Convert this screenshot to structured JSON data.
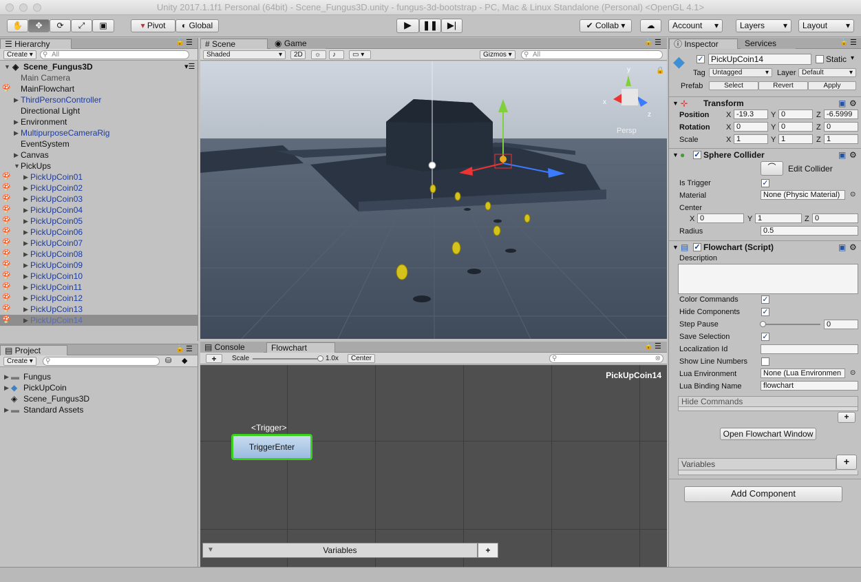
{
  "window_title": "Unity 2017.1.1f1 Personal (64bit) - Scene_Fungus3D.unity - fungus-3d-bootstrap - PC, Mac & Linux Standalone (Personal) <OpenGL 4.1>",
  "toolbar": {
    "pivot": "Pivot",
    "global": "Global",
    "collab": "Collab",
    "account": "Account",
    "layers": "Layers",
    "layout": "Layout"
  },
  "hierarchy": {
    "tab": "Hierarchy",
    "create": "Create",
    "search_placeholder": "All",
    "scene": "Scene_Fungus3D",
    "items": [
      {
        "label": "Main Camera"
      },
      {
        "label": "MainFlowchart"
      },
      {
        "label": "ThirdPersonController"
      },
      {
        "label": "Directional Light"
      },
      {
        "label": "Environment"
      },
      {
        "label": "MultipurposeCameraRig"
      },
      {
        "label": "EventSystem"
      },
      {
        "label": "Canvas"
      },
      {
        "label": "PickUps"
      },
      {
        "label": "PickUpCoin01"
      },
      {
        "label": "PickUpCoin02"
      },
      {
        "label": "PickUpCoin03"
      },
      {
        "label": "PickUpCoin04"
      },
      {
        "label": "PickUpCoin05"
      },
      {
        "label": "PickUpCoin06"
      },
      {
        "label": "PickUpCoin07"
      },
      {
        "label": "PickUpCoin08"
      },
      {
        "label": "PickUpCoin09"
      },
      {
        "label": "PickUpCoin10"
      },
      {
        "label": "PickUpCoin11"
      },
      {
        "label": "PickUpCoin12"
      },
      {
        "label": "PickUpCoin13"
      },
      {
        "label": "PickUpCoin14"
      }
    ]
  },
  "scene_view": {
    "tab_scene": "Scene",
    "tab_game": "Game",
    "shading": "Shaded",
    "mode_2d": "2D",
    "gizmos": "Gizmos",
    "search_placeholder": "All",
    "persp": "Persp",
    "axis_x": "x",
    "axis_y": "y",
    "axis_z": "z"
  },
  "project": {
    "tab": "Project",
    "create": "Create",
    "items": [
      {
        "label": "Fungus"
      },
      {
        "label": "PickUpCoin"
      },
      {
        "label": "Scene_Fungus3D"
      },
      {
        "label": "Standard Assets"
      }
    ]
  },
  "flowchart": {
    "tab_console": "Console",
    "tab_flowchart": "Flowchart",
    "add": "+",
    "scale_label": "Scale",
    "scale_value": "1.0x",
    "scale_level": 1.0,
    "center": "Center",
    "title": "PickUpCoin14",
    "block_event": "<Trigger>",
    "block_name": "TriggerEnter",
    "variables": "Variables"
  },
  "inspector": {
    "tab": "Inspector",
    "tab_services": "Services",
    "object_name": "PickUpCoin14",
    "static_label": "Static",
    "tag_label": "Tag",
    "tag_value": "Untagged",
    "layer_label": "Layer",
    "layer_value": "Default",
    "prefab_label": "Prefab",
    "prefab_select": "Select",
    "prefab_revert": "Revert",
    "prefab_apply": "Apply",
    "transform": {
      "title": "Transform",
      "position": "Position",
      "rotation": "Rotation",
      "scale": "Scale",
      "pos": [
        "-19.3",
        "0",
        "-6.5999"
      ],
      "rot": [
        "0",
        "0",
        "0"
      ],
      "scl": [
        "1",
        "1",
        "1"
      ]
    },
    "axis": {
      "x": "X",
      "y": "Y",
      "z": "Z"
    },
    "collider": {
      "title": "Sphere Collider",
      "edit": "Edit Collider",
      "is_trigger": "Is Trigger",
      "material": "Material",
      "material_value": "None (Physic Material)",
      "center": "Center",
      "center_vals": [
        "0",
        "1",
        "0"
      ],
      "radius": "Radius",
      "radius_value": "0.5"
    },
    "flowchart_script": {
      "title": "Flowchart (Script)",
      "description": "Description",
      "color_commands": "Color Commands",
      "hide_components": "Hide Components",
      "step_pause": "Step Pause",
      "step_pause_value": "0",
      "save_selection": "Save Selection",
      "localization_id": "Localization Id",
      "show_line_numbers": "Show Line Numbers",
      "lua_environment": "Lua Environment",
      "lua_environment_value": "None (Lua Environmen",
      "lua_binding_name": "Lua Binding Name",
      "lua_binding_value": "flowchart",
      "hide_commands": "Hide Commands",
      "open_window": "Open Flowchart Window",
      "variables": "Variables"
    },
    "add_component": "Add Component"
  }
}
